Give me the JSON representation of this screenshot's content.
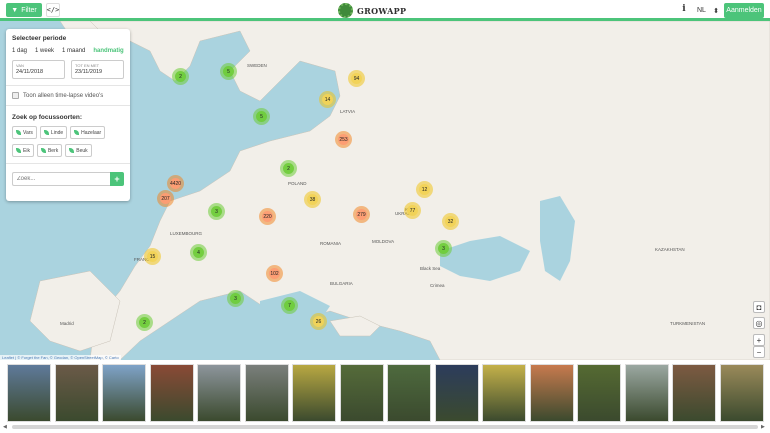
{
  "header": {
    "filter_label": "Filter",
    "code_label": "</>",
    "logo_text": "GROWAPP",
    "info_label": "i",
    "language": "NL",
    "login_label": "Aanmelden"
  },
  "panel": {
    "period_title": "Selecteer periode",
    "period_tabs": [
      "1 dag",
      "1 week",
      "1 maand",
      "handmatig"
    ],
    "from_label": "VAN",
    "from_value": "24/11/2018",
    "to_label": "TOT EN MET",
    "to_value": "23/11/2019",
    "timelapse_label": "Toon alleen time-lapse video's",
    "species_title": "Zoek op focussoorten:",
    "species_row1": [
      "Vars",
      "Linde",
      "Hazelaar"
    ],
    "species_row2": [
      "Eik",
      "Berk",
      "Beuk"
    ],
    "search_placeholder": "Zoek...",
    "search_button": "+"
  },
  "clusters": [
    {
      "label": "2",
      "color": "green"
    },
    {
      "label": "5",
      "color": "green"
    },
    {
      "label": "94",
      "color": "yellow"
    },
    {
      "label": "14",
      "color": "yellow"
    },
    {
      "label": "5",
      "color": "green"
    },
    {
      "label": "253",
      "color": "orange"
    },
    {
      "label": "2",
      "color": "green"
    },
    {
      "label": "4420",
      "color": "orange"
    },
    {
      "label": "207",
      "color": "orange"
    },
    {
      "label": "38",
      "color": "yellow"
    },
    {
      "label": "12",
      "color": "yellow"
    },
    {
      "label": "3",
      "color": "green"
    },
    {
      "label": "220",
      "color": "orange"
    },
    {
      "label": "279",
      "color": "orange"
    },
    {
      "label": "77",
      "color": "yellow"
    },
    {
      "label": "32",
      "color": "yellow"
    },
    {
      "label": "15",
      "color": "yellow"
    },
    {
      "label": "4",
      "color": "green"
    },
    {
      "label": "3",
      "color": "green"
    },
    {
      "label": "102",
      "color": "orange"
    },
    {
      "label": "3",
      "color": "green"
    },
    {
      "label": "7",
      "color": "green"
    },
    {
      "label": "2",
      "color": "green"
    },
    {
      "label": "26",
      "color": "yellow"
    }
  ],
  "places": [
    "SWEDEN",
    "LATVIA",
    "POLAND",
    "UKRAINE",
    "LUXEMBOURG",
    "FRANCE",
    "MOLDOVA",
    "ROMANIA",
    "BULGARIA",
    "Black Sea",
    "KAZAKHSTAN",
    "TURKMENISTAN",
    "Madrid",
    "Kyiv",
    "Crimea"
  ],
  "attribution": "Leaflet | © Forget the Fan, © Geodan, © OpenStreetMap, © Carto",
  "map_controls": [
    "camera-icon",
    "locate-icon",
    "+",
    "−"
  ],
  "thumbnails": [
    "#5f7a9a",
    "#6b5a48",
    "#7fa3c8",
    "#8a4a36",
    "#8d959c",
    "#7a7f7c",
    "#b8a842",
    "#556b3a",
    "#4e6a3e",
    "#2c3c5c",
    "#c4b14a",
    "#c77a4e",
    "#556a32",
    "#9ba8a2",
    "#7d5a42",
    "#9a8a5a"
  ],
  "colors": {
    "accent": "#4cc47a",
    "water": "#aad3df",
    "land": "#f2efe9"
  }
}
